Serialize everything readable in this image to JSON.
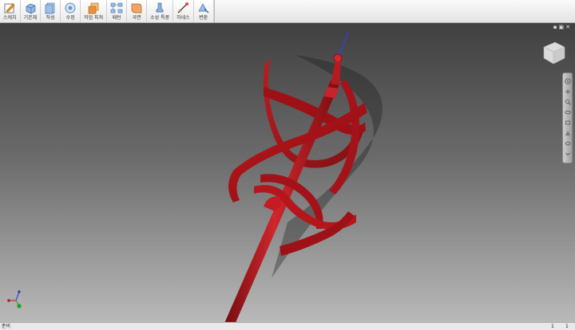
{
  "toolbar": {
    "tools": [
      {
        "label": "스케치",
        "icon": "sketch-icon"
      },
      {
        "label": "기본체",
        "icon": "primitive-icon"
      },
      {
        "label": "작성",
        "icon": "create-icon"
      },
      {
        "label": "수정",
        "icon": "modify-icon"
      },
      {
        "label": "작업 피쳐",
        "icon": "work-feature-icon"
      },
      {
        "label": "패턴",
        "icon": "pattern-icon"
      },
      {
        "label": "곡면",
        "icon": "surface-icon"
      },
      {
        "label": "소성 특풍",
        "icon": "plastic-part-icon"
      },
      {
        "label": "하네스",
        "icon": "harness-icon"
      },
      {
        "label": "변환",
        "icon": "convert-icon"
      }
    ]
  },
  "status": {
    "text": "준비",
    "count_1": "1",
    "count_2": "1"
  },
  "colors": {
    "model_red": "#b0141a",
    "axis_blue": "#3d3bd6"
  }
}
